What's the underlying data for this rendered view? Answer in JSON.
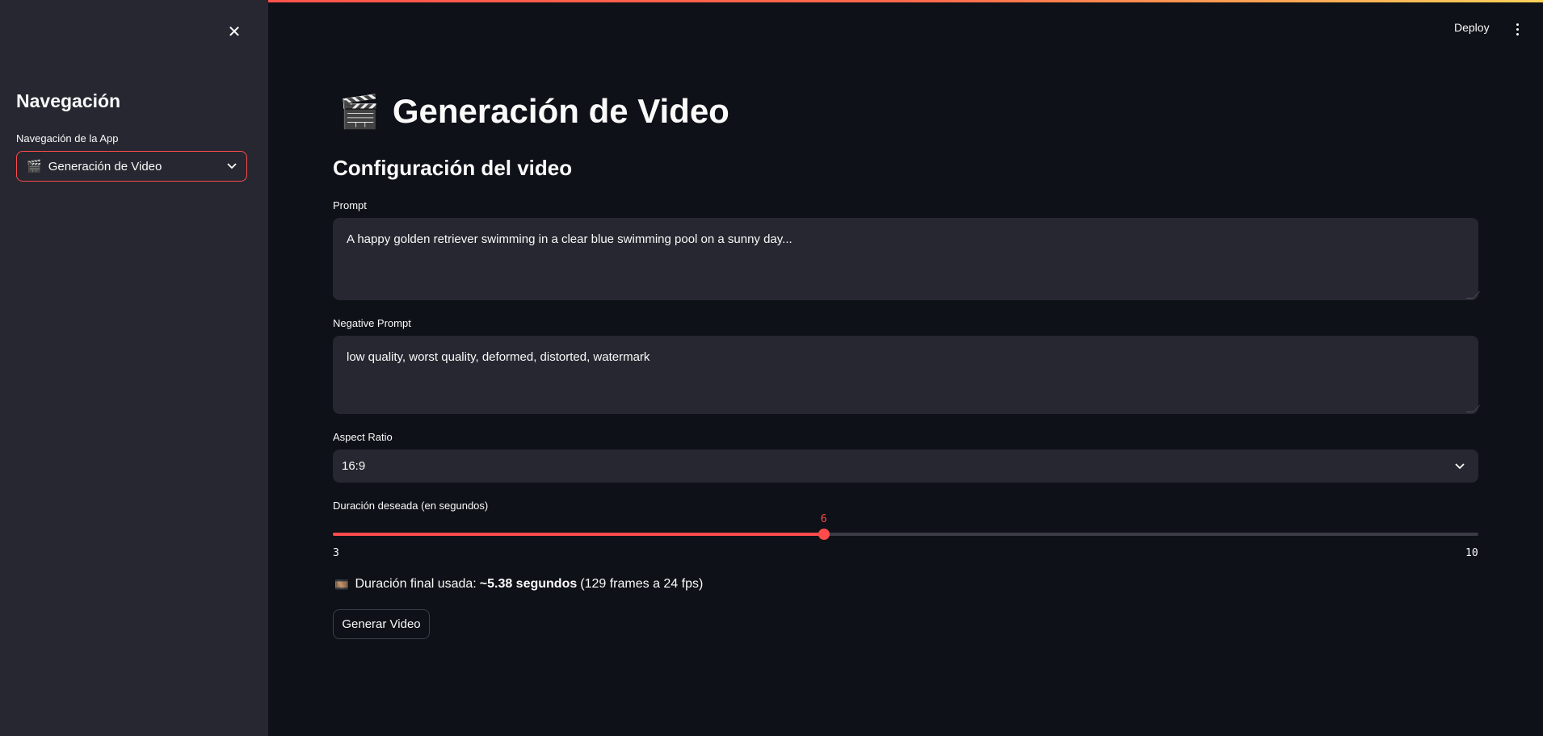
{
  "sidebar": {
    "close_icon": "✕",
    "title": "Navegación",
    "nav_label": "Navegación de la App",
    "nav_emoji": "🎬",
    "nav_selected": "Generación de Video"
  },
  "header": {
    "deploy_label": "Deploy"
  },
  "main": {
    "title_emoji": "🎬",
    "title": "Generación de Video",
    "section_title": "Configuración del video",
    "prompt": {
      "label": "Prompt",
      "value": "A happy golden retriever swimming in a clear blue swimming pool on a sunny day..."
    },
    "negative_prompt": {
      "label": "Negative Prompt",
      "value": "low quality, worst quality, deformed, distorted, watermark"
    },
    "aspect_ratio": {
      "label": "Aspect Ratio",
      "value": "16:9"
    },
    "duration": {
      "label": "Duración deseada (en segundos)",
      "min": 3,
      "max": 10,
      "value": 6
    },
    "final_duration": {
      "emoji": "🎞️",
      "prefix": "Duración final usada:",
      "bold": "~5.38 segundos",
      "suffix": "(129 frames a 24 fps)"
    },
    "generate_button": "Generar Video"
  },
  "colors": {
    "accent": "#ff4b4b",
    "background": "#0e1117",
    "sidebar": "#262730"
  }
}
